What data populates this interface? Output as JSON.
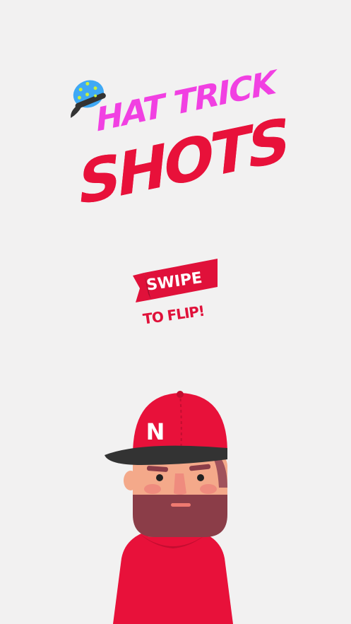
{
  "title": {
    "line1": "HAT TRICK",
    "line2": "SHOTS"
  },
  "prompt": {
    "main": "SWIPE",
    "sub": "TO FLIP!"
  },
  "character": {
    "cap_letter": "N"
  },
  "colors": {
    "background": "#f2f1f1",
    "title_pink": "#f140e2",
    "title_red": "#e8113a",
    "banner_red": "#e0113a",
    "cap_red": "#e8113a",
    "cap_brim": "#333333",
    "skin": "#f4a98a",
    "beard": "#8b3d48",
    "hair": "#a0525c",
    "shirt": "#e8113a",
    "logo_cap_blue": "#3fa9f5",
    "logo_cap_stars": "#c8f03c"
  },
  "icons": {
    "logo_cap": "baseball-cap-icon",
    "banner": "ribbon-banner-icon"
  }
}
